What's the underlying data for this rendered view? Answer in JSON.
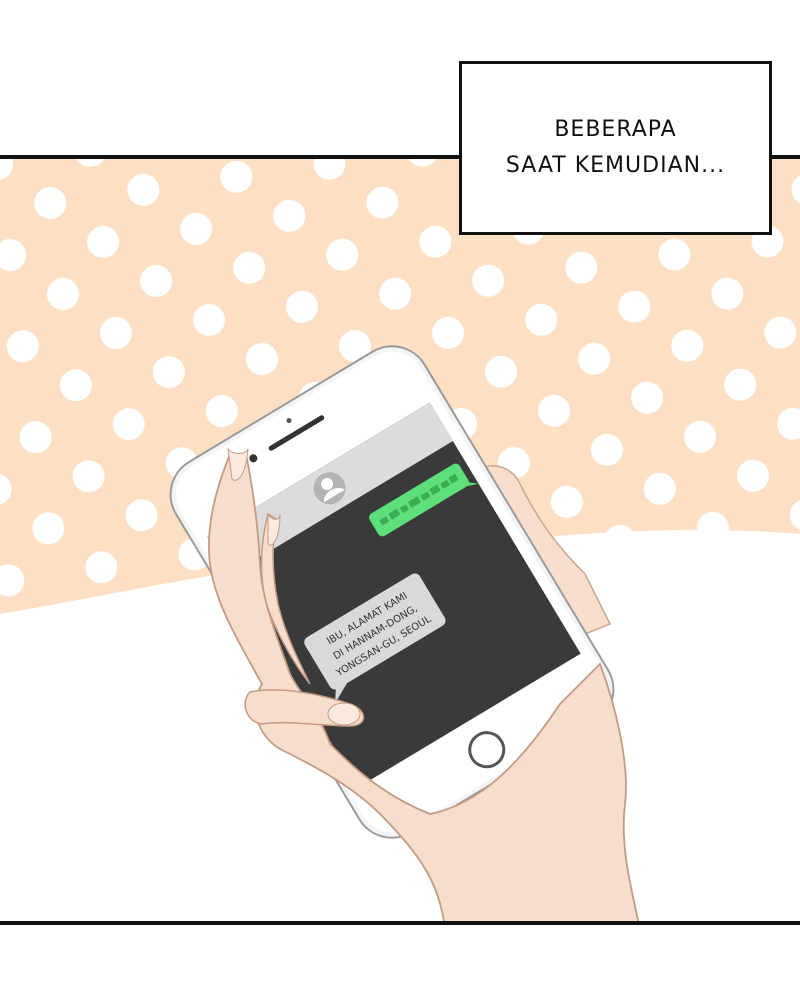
{
  "caption": {
    "line1": "BEBERAPA",
    "line2": "SAAT KEMUDIAN..."
  },
  "phone": {
    "incoming_message": [
      "IBU, ALAMAT KAMI",
      "DI HANNAM-DONG,",
      "YONGSAN-GU, SEOUL"
    ],
    "sent_message_redacted": true
  },
  "colors": {
    "background_peach": "#fde0c4",
    "dots": "#ffffff",
    "sent_bubble": "#5de07a",
    "received_bubble": "#d9d9d9",
    "screen": "#3a3a3a",
    "skin": "#f7ddcc"
  },
  "icons": {
    "contact": "contact-avatar-icon",
    "home_button": "home-button-icon"
  }
}
